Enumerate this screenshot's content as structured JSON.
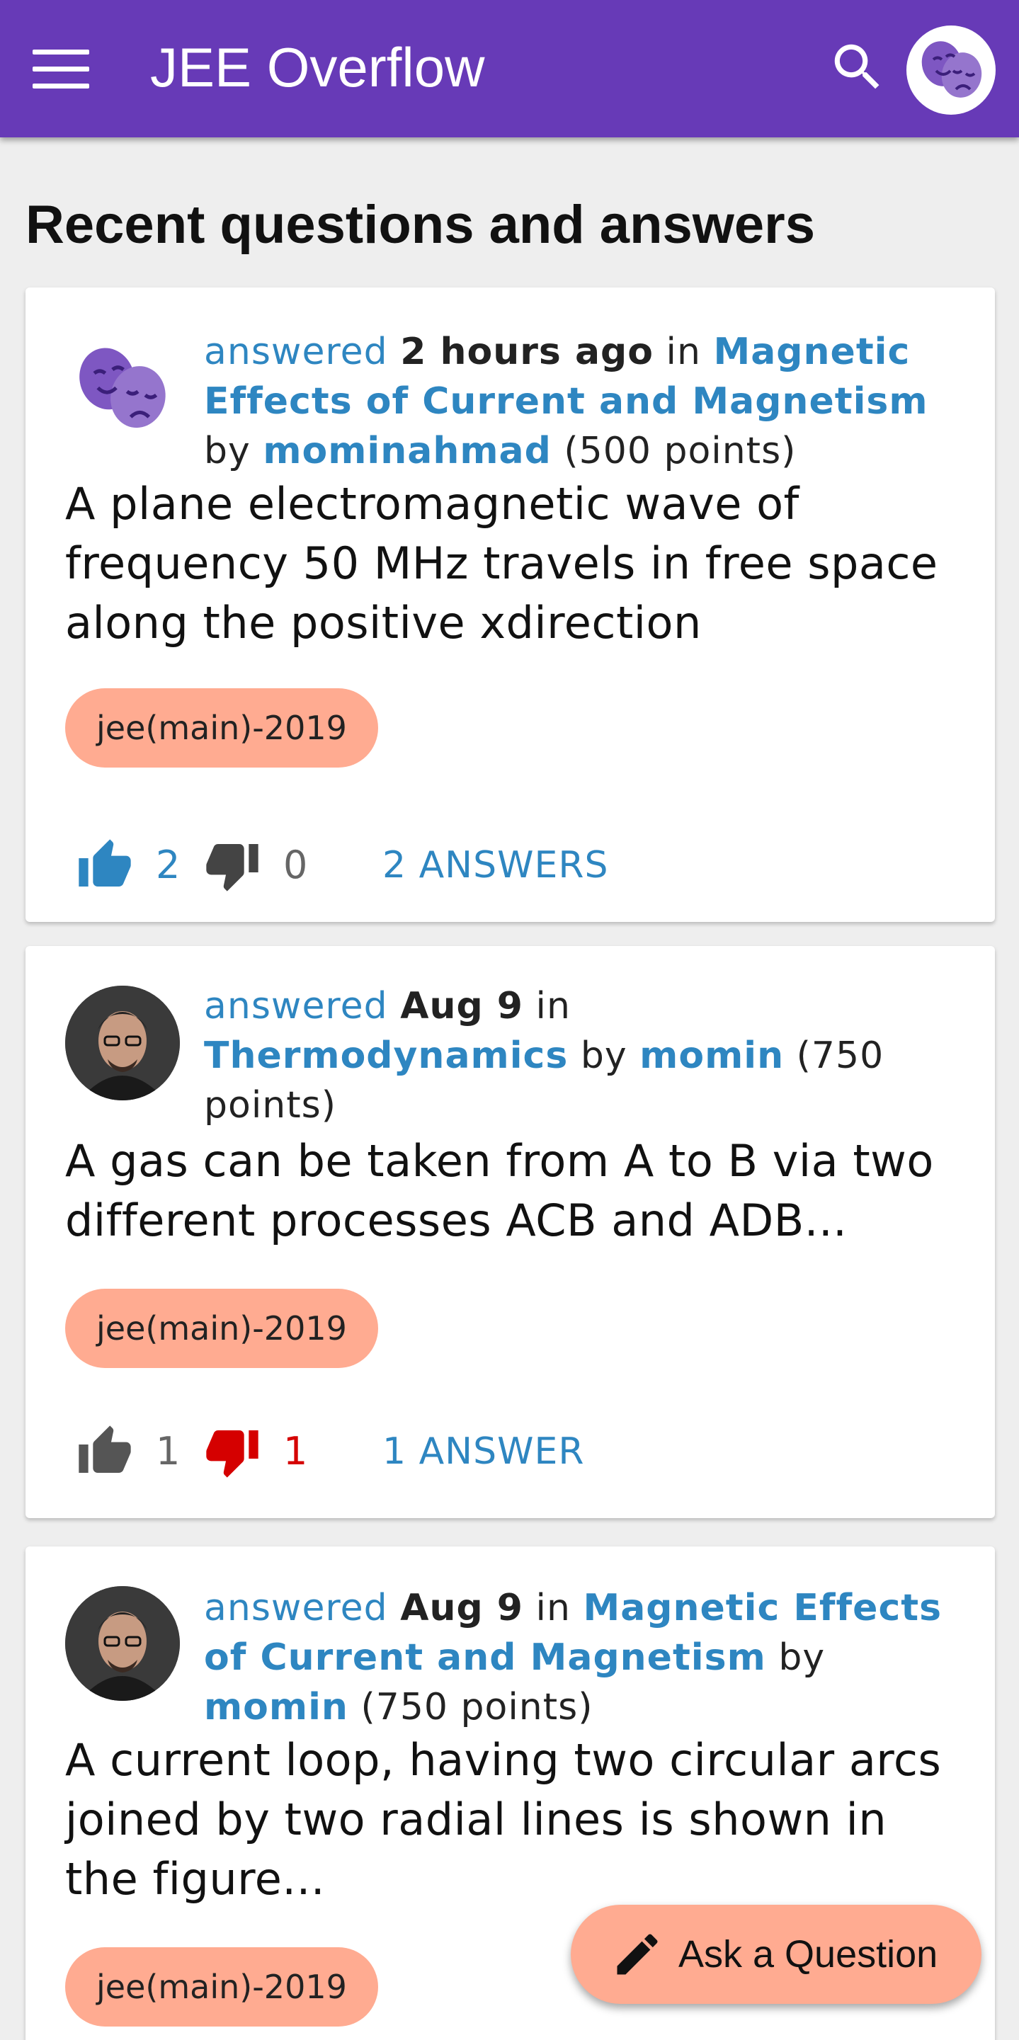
{
  "app": {
    "title": "JEE Overflow",
    "accent_color": "#673ab7",
    "link_color": "#2e86c1",
    "tag_color": "#ffab91",
    "menu_icon": "hamburger-menu-icon",
    "search_icon": "search-icon",
    "profile_icon": "theater-masks-avatar-icon"
  },
  "page": {
    "heading": "Recent questions and answers"
  },
  "posts": [
    {
      "avatar_icon": "theater-masks-avatar-icon",
      "action": "answered",
      "time": "2 hours ago",
      "in_word": "in",
      "category": "Magnetic Effects of Current and Magnetism",
      "by_word": "by",
      "user": "mominahmad",
      "points": "(500 points)",
      "title": "A plane electromagnetic wave of frequency 50 MHz travels in free space along the positive xdirection",
      "tag": "jee(main)-2019",
      "upvotes": "2",
      "downvotes": "0",
      "upvoted": true,
      "downvoted": false,
      "answers_label": "2 ANSWERS"
    },
    {
      "avatar_icon": "user-photo-avatar",
      "action": "answered",
      "time": "Aug 9",
      "in_word": "in",
      "category": "Thermodynamics",
      "by_word": "by",
      "user": "momin",
      "points": "(750 points)",
      "title": "A gas can be taken from A to B via two different processes ACB and ADB...",
      "tag": "jee(main)-2019",
      "upvotes": "1",
      "downvotes": "1",
      "upvoted": false,
      "downvoted": true,
      "answers_label": "1 ANSWER"
    },
    {
      "avatar_icon": "user-photo-avatar",
      "action": "answered",
      "time": "Aug 9",
      "in_word": "in",
      "category": "Magnetic Effects of Current and Magnetism",
      "by_word": "by",
      "user": "momin",
      "points": "(750 points)",
      "title": "A current loop, having two circular arcs joined by two radial lines is shown in the figure...",
      "tag": "jee(main)-2019"
    }
  ],
  "fab": {
    "label": "Ask a Question",
    "icon": "pencil-icon"
  }
}
